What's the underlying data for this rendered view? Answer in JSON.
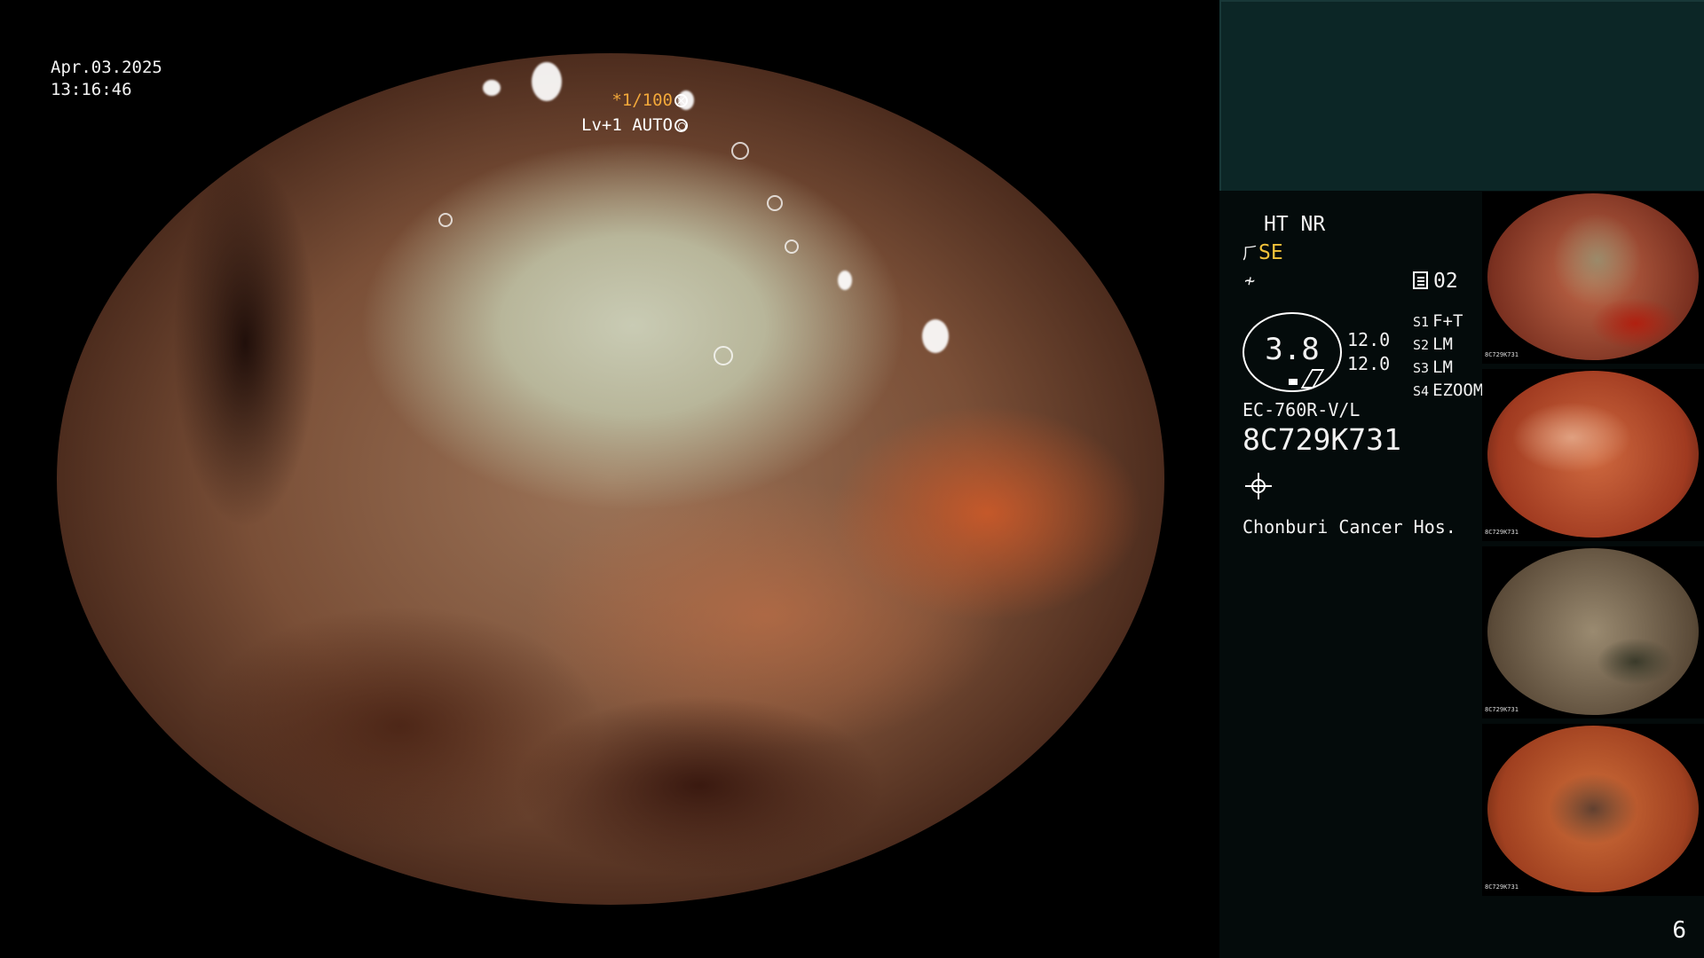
{
  "image": {
    "date": "Apr.03.2025",
    "time": "13:16:46",
    "shutter": "*1/100",
    "level": "Lv+1 AUTO"
  },
  "panel": {
    "mode": "HT NR",
    "se": "SE",
    "contrast_num": "02",
    "gauge_value": "3.8",
    "side_values": [
      "12.0",
      "12.0"
    ],
    "settings": [
      {
        "key": "S1",
        "value": "F+T"
      },
      {
        "key": "S2",
        "value": "LM"
      },
      {
        "key": "S3",
        "value": "LM"
      },
      {
        "key": "S4",
        "value": "EZOOM"
      }
    ],
    "scope_model": "EC-760R-V/L",
    "serial": "8C729K731",
    "hospital": "Chonburi Cancer Hos."
  },
  "thumbnails": [
    {
      "caption": "8C729K731"
    },
    {
      "caption": "8C729K731"
    },
    {
      "caption": "8C729K731"
    },
    {
      "caption": "8C729K731"
    }
  ],
  "page_number": "6",
  "colors": {
    "amber": "#f2c23a",
    "panel_top": "#0c2626",
    "panel_bg": "#040b0b"
  }
}
